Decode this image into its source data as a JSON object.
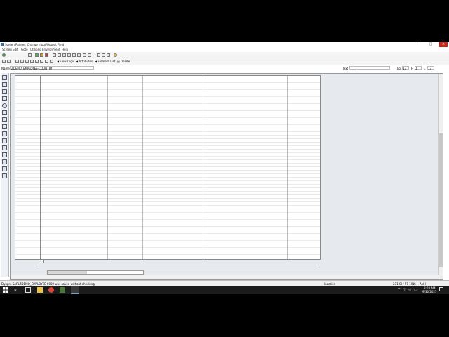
{
  "window": {
    "title": "Screen Painter: Change Input/Output Field",
    "menu": [
      "Screen",
      "Edit",
      "Goto",
      "Utilities",
      "Environment",
      "Help"
    ]
  },
  "toolbar": {
    "flow_logic": "Flow Logic",
    "attributes": "Attributes",
    "element_list": "Element List",
    "delete": "Delete"
  },
  "name_field": {
    "label": "Name",
    "value": "ZDEMO_EMPLOYEE-COUNTRY",
    "text_label": "Text",
    "text_value": "____",
    "lg_label": "Lg",
    "lg_value": "17",
    "h_label": "H",
    "h_value": "1",
    "l_label": "L",
    "l_value": "17"
  },
  "status": {
    "message": "Dynpro SAPLZDEMO_EMPLOYEE 0002 was saved without checking",
    "state": "Inactive",
    "position": "231 Cl / 97 1",
    "mode": "INS",
    "extra": "ANH"
  },
  "taskbar": {
    "time": "8:03 AM",
    "date": "9/30/2025"
  },
  "icons": {
    "palette": [
      "text-field-icon",
      "input-field-icon",
      "checkbox-icon",
      "radio-icon",
      "pushbutton-icon",
      "box-icon",
      "subscreen-icon",
      "table-control-icon",
      "tabstrip-icon",
      "tabstrip-wizard-icon",
      "custom-control-icon",
      "status-icon",
      "step-loop-icon",
      "table-wizard-icon"
    ]
  }
}
